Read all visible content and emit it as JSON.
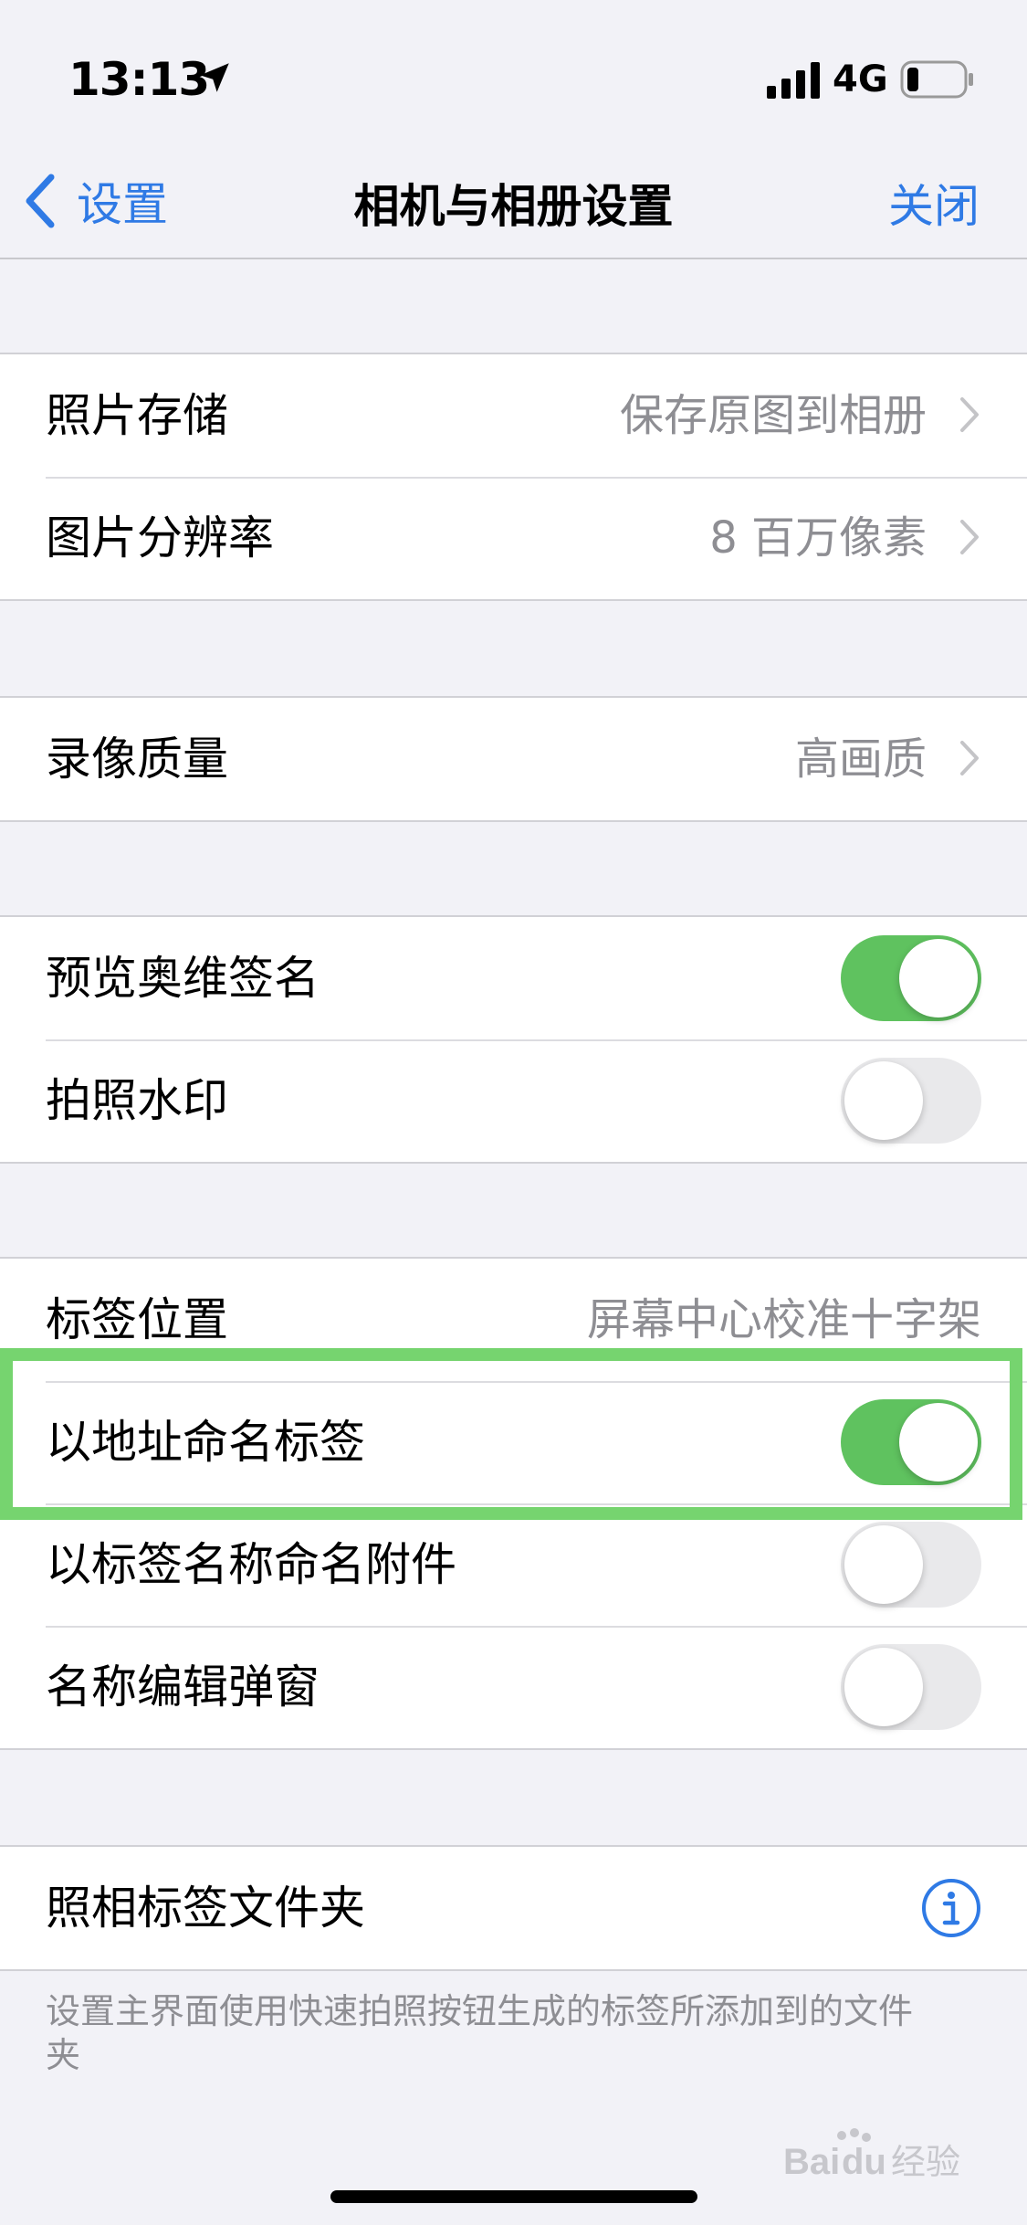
{
  "status": {
    "time": "13:13",
    "network": "4G"
  },
  "nav": {
    "back_label": "设置",
    "title": "相机与相册设置",
    "close_label": "关闭"
  },
  "groups": {
    "storage": [
      {
        "label": "照片存储",
        "value": "保存原图到相册"
      },
      {
        "label": "图片分辨率",
        "value": "8 百万像素"
      }
    ],
    "video": [
      {
        "label": "录像质量",
        "value": "高画质"
      }
    ],
    "watermark": [
      {
        "label": "预览奥维签名",
        "toggle_on": true
      },
      {
        "label": "拍照水印",
        "toggle_on": false
      }
    ],
    "tags": [
      {
        "label": "标签位置",
        "value": "屏幕中心校准十字架"
      },
      {
        "label": "以地址命名标签",
        "toggle_on": true
      },
      {
        "label": "以标签名称命名附件",
        "toggle_on": false
      },
      {
        "label": "名称编辑弹窗",
        "toggle_on": false
      }
    ],
    "folder": [
      {
        "label": "照相标签文件夹",
        "icon": "info-icon"
      }
    ]
  },
  "footer_note": "设置主界面使用快速拍照按钮生成的标签所添加到的文件夹",
  "watermark_logo": "Baidu经验",
  "colors": {
    "accent": "#2f7ae5",
    "toggle_on": "#5fc25f",
    "highlight": "#76d46f",
    "background": "#f2f2f7"
  }
}
